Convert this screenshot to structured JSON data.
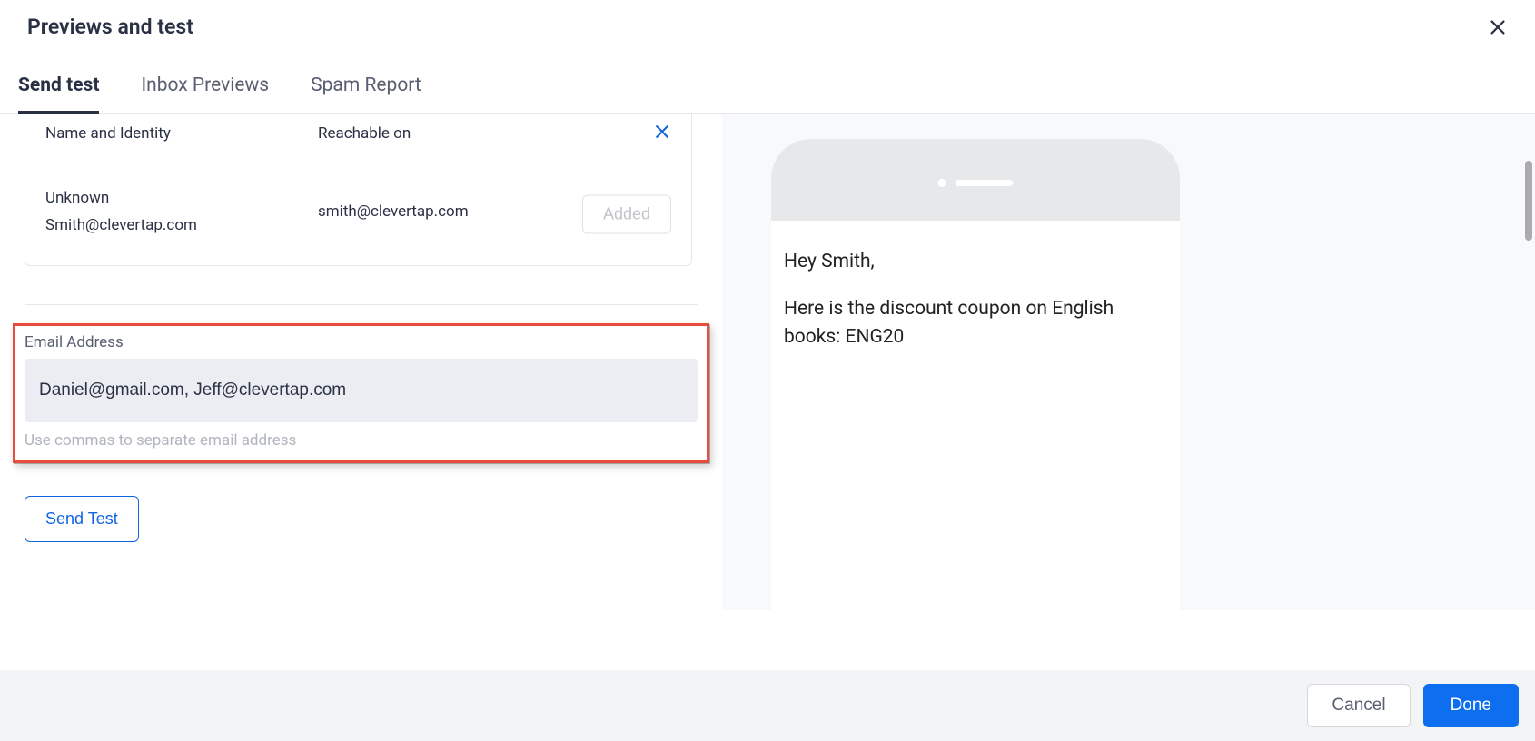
{
  "header": {
    "title": "Previews and test"
  },
  "tabs": {
    "items": [
      {
        "label": "Send test",
        "active": true
      },
      {
        "label": "Inbox Previews",
        "active": false
      },
      {
        "label": "Spam Report",
        "active": false
      }
    ]
  },
  "identity": {
    "columns": {
      "name": "Name and Identity",
      "reachable": "Reachable on"
    },
    "row": {
      "name": "Unknown",
      "identity": "Smith@clevertap.com",
      "reachable": "smith@clevertap.com",
      "added_label": "Added"
    }
  },
  "email": {
    "label": "Email Address",
    "value": "Daniel@gmail.com, Jeff@clevertap.com",
    "hint": "Use commas to separate email address"
  },
  "actions": {
    "send_test": "Send Test"
  },
  "preview": {
    "greeting": "Hey Smith,",
    "body": "Here is the discount coupon on English books: ENG20"
  },
  "footer": {
    "cancel": "Cancel",
    "done": "Done"
  }
}
